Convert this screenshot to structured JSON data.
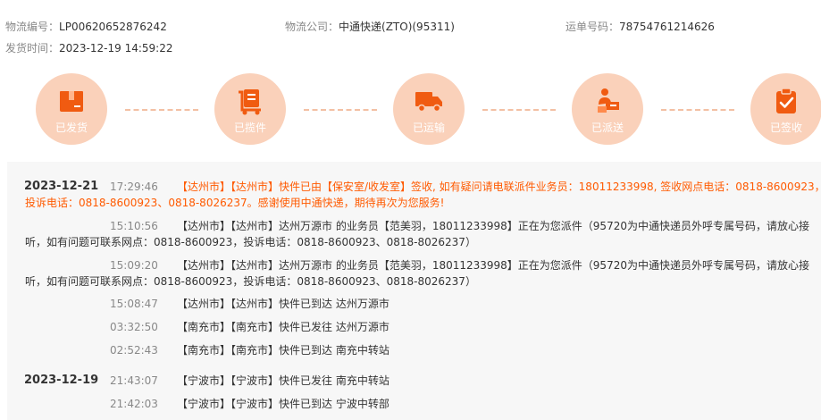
{
  "header": {
    "order_label": "物流编号：",
    "order_value": "LP00620652876242",
    "carrier_label": "物流公司：",
    "carrier_value": "中通快递(ZTO)(95311)",
    "waybill_label": "运单号码：",
    "waybill_value": "78754761214626",
    "ship_label": "发货时间：",
    "ship_value": "2023-12-19 14:59:22"
  },
  "steps": [
    {
      "label": "已发货",
      "icon": "package-icon"
    },
    {
      "label": "已揽件",
      "icon": "clipboard-cart-icon"
    },
    {
      "label": "已运输",
      "icon": "truck-icon"
    },
    {
      "label": "已派送",
      "icon": "courier-icon"
    },
    {
      "label": "已签收",
      "icon": "checklist-icon"
    }
  ],
  "colors": {
    "accent": "#ff5a00",
    "step_bg": "#fad1ba",
    "icon": "#f05b11"
  },
  "timeline": [
    {
      "date": "2023-12-21",
      "time": "17:29:46",
      "line1": "【达州市】【达州市】快件已由【保安室/收发室】签收, 如有疑问请电联派件业务员：18011233998, 签收网点电话：0818-8600923，",
      "line2": "投诉电话：0818-8600923、0818-8026237。感谢使用中通快递，期待再次为您服务!"
    },
    {
      "date": "",
      "time": "15:10:56",
      "line1": "【达州市】【达州市】达州万源市 的业务员【范美羽，18011233998】正在为您派件（95720为中通快递员外呼专属号码，请放心接",
      "line2": "听，如有问题可联系网点：0818-8600923，投诉电话：0818-8600923、0818-8026237）"
    },
    {
      "date": "",
      "time": "15:09:20",
      "line1": "【达州市】【达州市】达州万源市 的业务员【范美羽，18011233998】正在为您派件（95720为中通快递员外呼专属号码，请放心接",
      "line2": "听，如有问题可联系网点：0818-8600923，投诉电话：0818-8600923、0818-8026237）"
    },
    {
      "date": "",
      "time": "15:08:47",
      "line1": "【达州市】【达州市】快件已到达 达州万源市",
      "line2": ""
    },
    {
      "date": "",
      "time": "03:32:50",
      "line1": "【南充市】【南充市】快件已发往 达州万源市",
      "line2": ""
    },
    {
      "date": "",
      "time": "02:52:43",
      "line1": "【南充市】【南充市】快件已到达 南充中转站",
      "line2": ""
    },
    {
      "date": "2023-12-19",
      "time": "21:43:07",
      "line1": "【宁波市】【宁波市】快件已发往 南充中转站",
      "line2": ""
    },
    {
      "date": "",
      "time": "21:42:03",
      "line1": "【宁波市】【宁波市】快件已到达 宁波中转部",
      "line2": ""
    }
  ]
}
